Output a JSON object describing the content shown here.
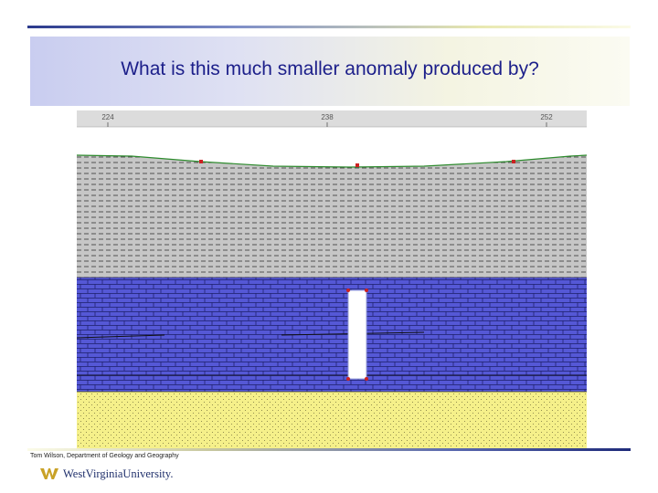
{
  "slide": {
    "title": "What is this much smaller anomaly produced by?",
    "credit": "Tom Wilson, Department of Geology and Geography",
    "logo_text": "WestVirginiaUniversity.",
    "logo_icon": "wvu-flying-wv-icon"
  },
  "profile": {
    "axis_ticks": [
      "224",
      "238",
      "252"
    ],
    "layers": [
      "shale",
      "limestone",
      "sandstone"
    ],
    "colors": {
      "ruler": "#dcdcdc",
      "shale": "#c6c6c6",
      "limestone": "#5558d6",
      "sandstone": "#f5f08a",
      "surface": "#2e8b2e",
      "station": "#cc2222",
      "body": "#ffffff"
    },
    "anomalous_body": "white-rectangular-body-in-limestone"
  }
}
